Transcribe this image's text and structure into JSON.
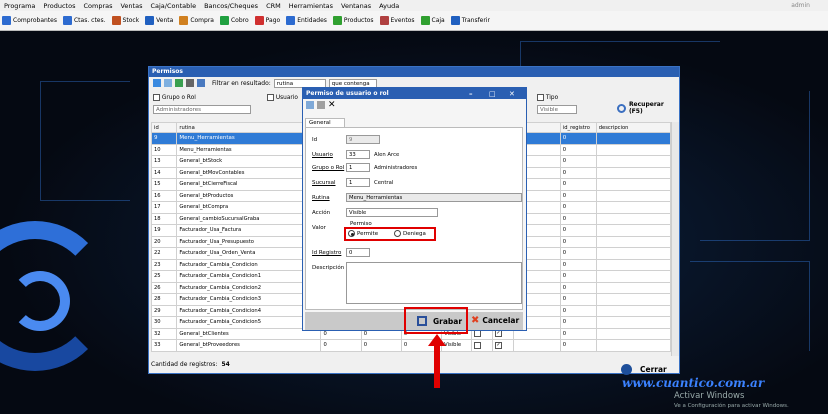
{
  "menu": [
    "Programa",
    "Productos",
    "Compras",
    "Ventas",
    "Caja/Contable",
    "Bancos/Cheques",
    "CRM",
    "Herramientas",
    "Ventanas",
    "Ayuda"
  ],
  "user": "admin",
  "toolbar": [
    {
      "label": "Comprobantes",
      "icon": "document-icon",
      "color": "#2d6bd0"
    },
    {
      "label": "Ctas. ctes.",
      "icon": "accounts-icon",
      "color": "#2d6bd0"
    },
    {
      "label": "Stock",
      "icon": "stock-icon",
      "color": "#c05020"
    },
    {
      "label": "Venta",
      "icon": "sale-icon",
      "color": "#2060c0"
    },
    {
      "label": "Compra",
      "icon": "cart-icon",
      "color": "#d08020"
    },
    {
      "label": "Cobro",
      "icon": "dollar-in-icon",
      "color": "#20a040"
    },
    {
      "label": "Pago",
      "icon": "dollar-out-icon",
      "color": "#d03030"
    },
    {
      "label": "Entidades",
      "icon": "entities-icon",
      "color": "#2d6bd0"
    },
    {
      "label": "Productos",
      "icon": "products-icon",
      "color": "#30a030"
    },
    {
      "label": "Eventos",
      "icon": "calendar-icon",
      "color": "#b04040"
    },
    {
      "label": "Caja",
      "icon": "cashbox-icon",
      "color": "#30a030"
    },
    {
      "label": "Transferir",
      "icon": "transfer-icon",
      "color": "#2060c0"
    }
  ],
  "window": {
    "title": "Permisos",
    "filter_label": "Filtrar en resultado:",
    "filter_field": "rutina",
    "filter_mode": "que contenga",
    "grupo_label": "Grupo o Rol",
    "grupo_value": "Administradores",
    "usuario_label": "Usuario",
    "tipo_label": "Tipo",
    "tipo_value": "Visible",
    "recuperar_label": "Recuperar (F5)",
    "columns": [
      "id",
      "rutina",
      "",
      "",
      "",
      "",
      "",
      "",
      "xto",
      "id_registro",
      "descripcion"
    ],
    "rows": [
      {
        "id": "9",
        "rutina": "Menu_Herramientas",
        "reg": "0",
        "selected": true
      },
      {
        "id": "10",
        "rutina": "Menu_Herramientas",
        "reg": "0"
      },
      {
        "id": "13",
        "rutina": "General_btStock",
        "reg": "0"
      },
      {
        "id": "14",
        "rutina": "General_btMovContables",
        "reg": "0"
      },
      {
        "id": "15",
        "rutina": "General_btCierreFiscal",
        "reg": "0"
      },
      {
        "id": "16",
        "rutina": "General_btProductos",
        "reg": "0"
      },
      {
        "id": "17",
        "rutina": "General_btCompra",
        "reg": "0"
      },
      {
        "id": "18",
        "rutina": "General_cambioSucursalGraba",
        "reg": "0"
      },
      {
        "id": "19",
        "rutina": "Facturador_Usa_Factura",
        "reg": "0"
      },
      {
        "id": "20",
        "rutina": "Facturador_Usa_Presupuesto",
        "reg": "0"
      },
      {
        "id": "22",
        "rutina": "Facturador_Usa_Orden_Venta",
        "reg": "0"
      },
      {
        "id": "23",
        "rutina": "Facturador_Cambia_Condicion",
        "reg": "0"
      },
      {
        "id": "25",
        "rutina": "Facturador_Cambia_Condicion1",
        "reg": "0"
      },
      {
        "id": "26",
        "rutina": "Facturador_Cambia_Condicion2",
        "reg": "0"
      },
      {
        "id": "28",
        "rutina": "Facturador_Cambia_Condicion3",
        "reg": "0"
      },
      {
        "id": "29",
        "rutina": "Facturador_Cambia_Condicion4",
        "reg": "0"
      },
      {
        "id": "30",
        "rutina": "Facturador_Cambia_Condicion5",
        "reg": "0"
      },
      {
        "id": "32",
        "rutina": "General_btClientes",
        "reg": "0",
        "c3": "0",
        "c4": "0",
        "c5": "0",
        "tipo": "Visible"
      },
      {
        "id": "33",
        "rutina": "General_btProveedores",
        "reg": "0",
        "c3": "0",
        "c4": "0",
        "c5": "0",
        "tipo": "Visible"
      }
    ],
    "count_label": "Cantidad de registros:",
    "count_value": "54",
    "cerrar_label": "Cerrar"
  },
  "dialog": {
    "title": "Permiso de usuario o rol",
    "tab": "General",
    "fields": {
      "id_label": "Id",
      "id_value": "9",
      "usuario_label": "Usuario",
      "usuario_id": "33",
      "usuario_name": "Alen Arce",
      "grupo_label": "Grupo o Rol",
      "grupo_id": "1",
      "grupo_name": "Administradores",
      "sucursal_label": "Sucursal",
      "sucursal_id": "1",
      "sucursal_name": "Central",
      "rutina_label": "Rutina",
      "rutina_value": "Menu_Herramientas",
      "accion_label": "Acción",
      "accion_value": "Visible",
      "valor_label": "Valor",
      "permiso_label": "Permiso",
      "permite_label": "Permite",
      "deniega_label": "Deniega",
      "registro_label": "Id Registro",
      "registro_value": "0",
      "descripcion_label": "Descripción"
    },
    "grabar_label": "Grabar",
    "cancelar_label": "Cancelar"
  },
  "brand": "www.cuantico.com.ar",
  "watermark_title": "Activar Windows",
  "watermark_sub": "Ve a Configuración para activar Windows."
}
